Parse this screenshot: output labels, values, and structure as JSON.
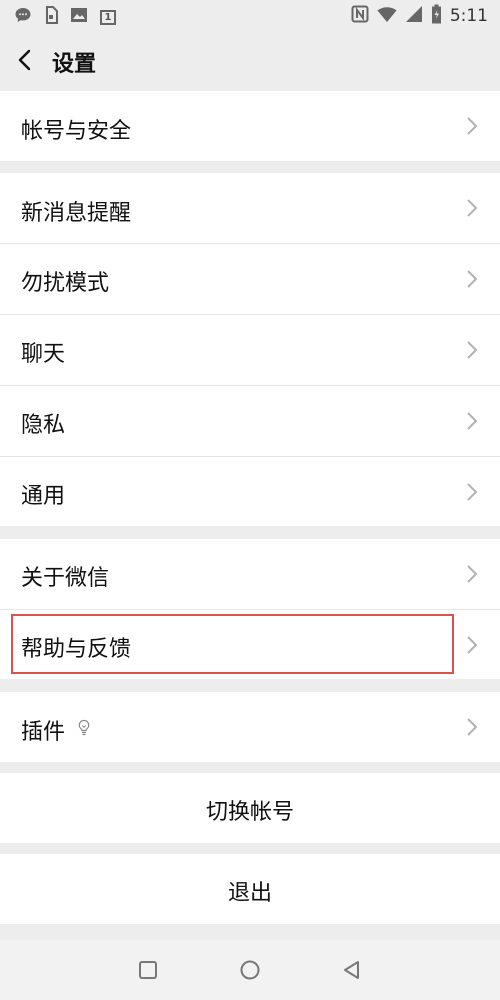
{
  "status_bar": {
    "time": "5:11",
    "notification_badge": "1",
    "left_icons": [
      "chat-bubble-icon",
      "sim-card-icon",
      "image-icon",
      "notification-count-icon"
    ],
    "right_icons": [
      "nfc-icon",
      "wifi-icon",
      "signal-icon",
      "battery-icon"
    ]
  },
  "header": {
    "title": "设置",
    "back_icon": "chevron-left-icon"
  },
  "menu": {
    "account_security": "帐号与安全",
    "new_message_alerts": "新消息提醒",
    "do_not_disturb": "勿扰模式",
    "chats": "聊天",
    "privacy": "隐私",
    "general": "通用",
    "about": "关于微信",
    "help_feedback": "帮助与反馈",
    "plugins": "插件",
    "plugins_icon": "lightbulb-icon"
  },
  "actions": {
    "switch_account": "切换帐号",
    "logout": "退出"
  },
  "system_nav": {
    "icons": [
      "recent-apps-square-icon",
      "home-circle-icon",
      "back-triangle-icon"
    ]
  },
  "colors": {
    "background": "#ededed",
    "row_background": "#ffffff",
    "highlight_border": "#d9534f"
  }
}
